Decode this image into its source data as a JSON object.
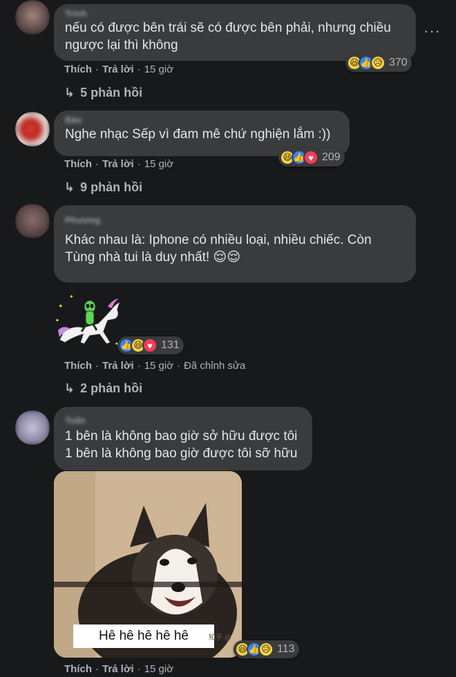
{
  "comments": [
    {
      "author": "Trinh",
      "text": "nếu có được bên trái sẽ có được bên phải, nhưng chiều\nngược lại thì không",
      "reaction_count": "370",
      "reactions": [
        "haha",
        "like",
        "sad"
      ],
      "actions": {
        "like": "Thích",
        "reply": "Trả lời",
        "time": "15 giờ"
      },
      "replies": "5 phản hồi"
    },
    {
      "author": "Bảo",
      "text": "Nghe nhạc Sếp vì đam mê chứ nghiện lắm :))",
      "reaction_count": "209",
      "reactions": [
        "haha",
        "like",
        "love"
      ],
      "actions": {
        "like": "Thích",
        "reply": "Trả lời",
        "time": "15 giờ"
      },
      "replies": "9 phản hồi"
    },
    {
      "author": "Phương",
      "text": "Khác nhau là: Iphone có nhiều loại, nhiều chiếc. Còn\nTùng nhà tui là duy nhất! 😌😌",
      "sticker_reaction_count": "131",
      "reactions": [
        "like",
        "haha",
        "love"
      ],
      "actions": {
        "like": "Thích",
        "reply": "Trả lời",
        "time": "15 giờ",
        "edited": "Đã chỉnh sửa"
      },
      "replies": "2 phản hồi"
    },
    {
      "author": "Tuấn",
      "text": "1 bên là không bao giờ sở hữu được tôi\n1 bên là không bao giờ được tôi sỡ hữu",
      "photo_caption": "Hê hê hê hê hê",
      "reaction_count": "113",
      "reactions": [
        "haha",
        "like",
        "sad"
      ],
      "actions": {
        "like": "Thích",
        "reply": "Trả lời",
        "time": "15 giờ"
      }
    }
  ],
  "icons": {
    "reply_arrow": "↳",
    "more": "···"
  },
  "colors": {
    "background": "#18191a",
    "bubble": "#3a3b3c",
    "like": "#2d88ff",
    "love": "#f33e58",
    "haha": "#f7d44a"
  }
}
